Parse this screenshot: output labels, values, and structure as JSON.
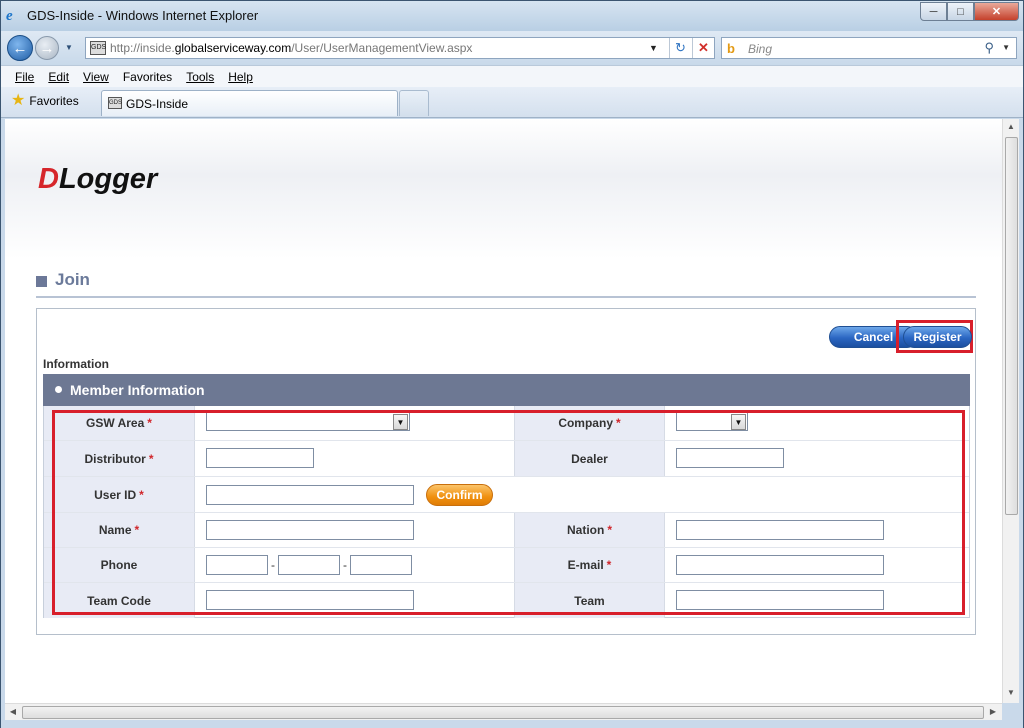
{
  "window": {
    "title": "GDS-Inside - Windows Internet Explorer"
  },
  "address": {
    "url_prefix": "http://inside.",
    "url_domain": "globalserviceway.com",
    "url_path": "/User/UserManagementView.aspx"
  },
  "search": {
    "placeholder": "Bing"
  },
  "menu": {
    "file": "File",
    "edit": "Edit",
    "view": "View",
    "favorites": "Favorites",
    "tools": "Tools",
    "help": "Help"
  },
  "favorites": {
    "label": "Favorites"
  },
  "tab": {
    "label": "GDS-Inside"
  },
  "page": {
    "logo_first": "D",
    "logo_rest": "Logger",
    "heading": "Join",
    "cancel": "Cancel",
    "register": "Register",
    "info_label": "Information",
    "section_title": "Member Information",
    "confirm": "Confirm"
  },
  "form": {
    "gsw_area": "GSW Area",
    "company": "Company",
    "distributor": "Distributor",
    "dealer": "Dealer",
    "user_id": "User ID",
    "name": "Name",
    "nation": "Nation",
    "phone": "Phone",
    "email": "E-mail",
    "team_code": "Team Code",
    "team": "Team",
    "required_mark": "*",
    "phone_sep": "-"
  },
  "colors": {
    "highlight": "#d81f2b",
    "section_bar": "#6d7893",
    "required": "#d0262b"
  }
}
